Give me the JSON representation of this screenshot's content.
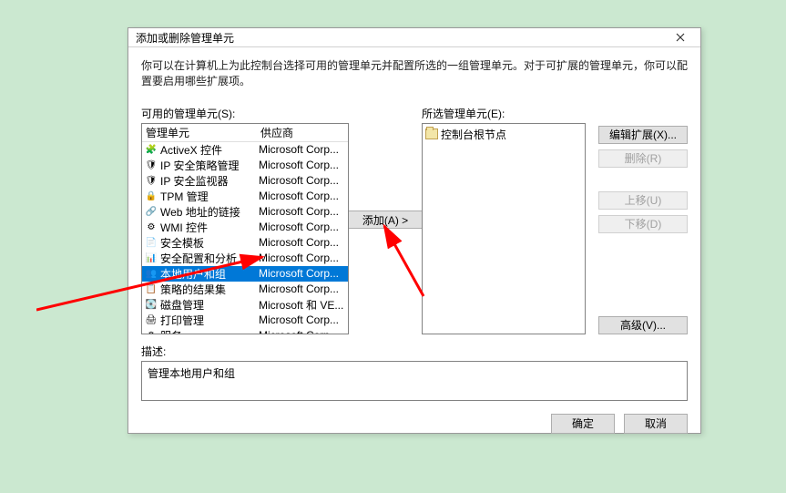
{
  "dialog": {
    "title": "添加或删除管理单元",
    "desc": "你可以在计算机上为此控制台选择可用的管理单元并配置所选的一组管理单元。对于可扩展的管理单元，你可以配置要启用哪些扩展项。"
  },
  "available": {
    "label": "可用的管理单元(S):",
    "columns": {
      "name": "管理单元",
      "vendor": "供应商"
    },
    "items": [
      {
        "name": "ActiveX 控件",
        "vendor": "Microsoft Corp...",
        "icon": "🧩",
        "selected": false
      },
      {
        "name": "IP 安全策略管理",
        "vendor": "Microsoft Corp...",
        "icon": "🛡",
        "selected": false
      },
      {
        "name": "IP 安全监视器",
        "vendor": "Microsoft Corp...",
        "icon": "🛡",
        "selected": false
      },
      {
        "name": "TPM 管理",
        "vendor": "Microsoft Corp...",
        "icon": "🔒",
        "selected": false
      },
      {
        "name": "Web 地址的链接",
        "vendor": "Microsoft Corp...",
        "icon": "🔗",
        "selected": false
      },
      {
        "name": "WMI 控件",
        "vendor": "Microsoft Corp...",
        "icon": "⚙",
        "selected": false
      },
      {
        "name": "安全模板",
        "vendor": "Microsoft Corp...",
        "icon": "📄",
        "selected": false
      },
      {
        "name": "安全配置和分析",
        "vendor": "Microsoft Corp...",
        "icon": "📊",
        "selected": false
      },
      {
        "name": "本地用户和组",
        "vendor": "Microsoft Corp...",
        "icon": "👥",
        "selected": true
      },
      {
        "name": "策略的结果集",
        "vendor": "Microsoft Corp...",
        "icon": "📋",
        "selected": false
      },
      {
        "name": "磁盘管理",
        "vendor": "Microsoft 和 VE...",
        "icon": "💽",
        "selected": false
      },
      {
        "name": "打印管理",
        "vendor": "Microsoft Corp...",
        "icon": "🖨",
        "selected": false
      },
      {
        "name": "服务",
        "vendor": "Microsoft Corp...",
        "icon": "⚙",
        "selected": false
      }
    ]
  },
  "add_button": "添加(A) >",
  "selected": {
    "label": "所选管理单元(E):",
    "root": "控制台根节点"
  },
  "side_buttons": {
    "edit_ext": "编辑扩展(X)...",
    "remove": "删除(R)",
    "move_up": "上移(U)",
    "move_down": "下移(D)",
    "advanced": "高级(V)..."
  },
  "description": {
    "label": "描述:",
    "text": "管理本地用户和组"
  },
  "footer": {
    "ok": "确定",
    "cancel": "取消"
  },
  "annotation_color": "#ff0000"
}
